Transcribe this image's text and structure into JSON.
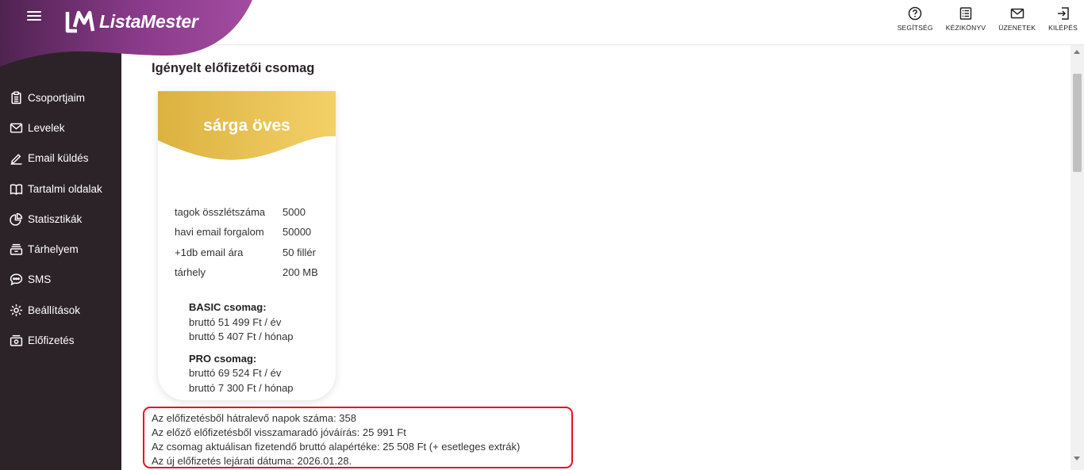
{
  "app": {
    "brand": "ListaMester",
    "colors": {
      "sidebar": "#2c2329",
      "brand_purple": "#8b3c8e",
      "accent_red": "#e8101d",
      "card_gold": "#e0bb45"
    }
  },
  "header": {
    "actions": [
      {
        "label": "SEGÍTSÉG",
        "icon": "help-icon"
      },
      {
        "label": "KÉZIKÖNYV",
        "icon": "manual-icon"
      },
      {
        "label": "ÜZENETEK",
        "icon": "mail-icon"
      },
      {
        "label": "KILÉPÉS",
        "icon": "logout-icon"
      }
    ]
  },
  "sidebar": {
    "items": [
      {
        "label": "Csoportjaim",
        "icon": "clipboard-icon"
      },
      {
        "label": "Levelek",
        "icon": "envelope-icon"
      },
      {
        "label": "Email küldés",
        "icon": "pencil-icon"
      },
      {
        "label": "Tartalmi oldalak",
        "icon": "book-icon"
      },
      {
        "label": "Statisztikák",
        "icon": "pie-chart-icon"
      },
      {
        "label": "Tárhelyem",
        "icon": "storage-icon"
      },
      {
        "label": "SMS",
        "icon": "chat-icon"
      },
      {
        "label": "Beállítások",
        "icon": "gear-icon"
      },
      {
        "label": "Előfizetés",
        "icon": "subscription-icon"
      }
    ]
  },
  "main": {
    "title": "Igényelt előfizetői csomag",
    "package": {
      "name": "sárga öves",
      "features": [
        {
          "name": "tagok összlétszáma",
          "value": "5000"
        },
        {
          "name": "havi email forgalom",
          "value": "50000"
        },
        {
          "name": "+1db email ára",
          "value": "50 fillér"
        },
        {
          "name": "tárhely",
          "value": "200 MB"
        }
      ],
      "basic": {
        "heading": "BASIC csomag:",
        "yearly": "bruttó 51 499 Ft / év",
        "monthly": "bruttó 5 407 Ft / hónap"
      },
      "pro": {
        "heading": "PRO csomag:",
        "yearly": "bruttó 69 524 Ft / év",
        "monthly": "bruttó 7 300 Ft / hónap"
      }
    },
    "info": [
      "Az előfizetésből hátralevő napok száma: 358",
      "Az előző előfizetésből visszamaradó jóváírás: 25 991 Ft",
      "Az csomag aktuálisan fizetendő bruttó alapértéke: 25 508 Ft (+ esetleges extrák)",
      "Az új előfizetés lejárati dátuma: 2026.01.28."
    ]
  }
}
